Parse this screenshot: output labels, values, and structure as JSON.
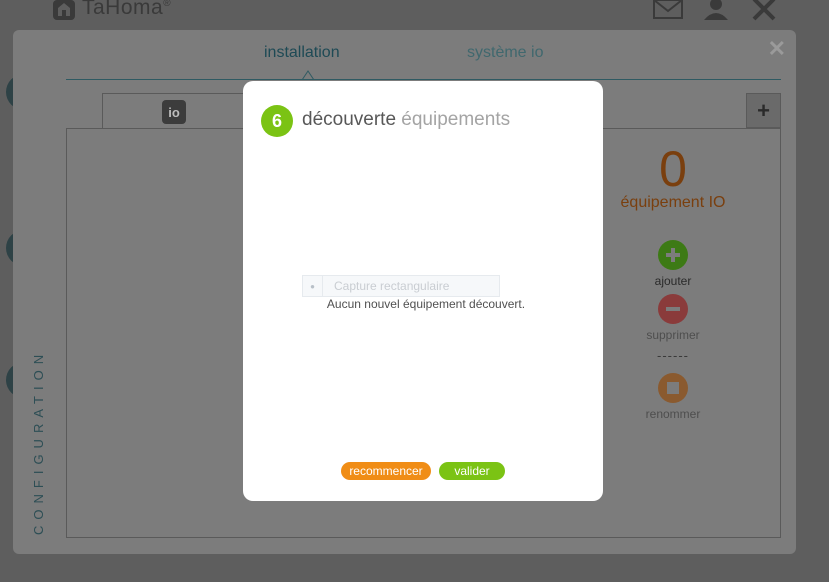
{
  "app": {
    "logo_text": "TaHoma",
    "logo_mark": "®",
    "icons": [
      "house-icon",
      "mail-icon",
      "user-icon",
      "close-icon"
    ]
  },
  "panel": {
    "tabs": [
      {
        "label": "installation"
      },
      {
        "label": "système io"
      }
    ],
    "inner_tab_badge": "io",
    "side_label": "CONFIGURATION",
    "plus": "+",
    "close": "✕"
  },
  "equipment": {
    "count": "0",
    "count_label": "équipement IO",
    "actions": [
      {
        "label": "ajouter"
      },
      {
        "label": "supprimer"
      },
      {
        "label": "renommer"
      }
    ],
    "separator": "------"
  },
  "modal": {
    "step": "6",
    "title_main": "découverte",
    "title_secondary": "équipements",
    "capture_placeholder": "Capture rectangulaire",
    "message": "Aucun nouvel équipement découvert.",
    "buttons": {
      "restart": "recommencer",
      "validate": "valider"
    }
  },
  "colors": {
    "accent_green": "#7bc314",
    "accent_orange": "#f08d16",
    "teal": "#1e4a55"
  }
}
